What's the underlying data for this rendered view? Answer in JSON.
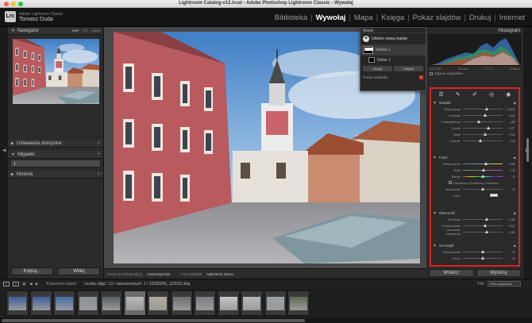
{
  "window": {
    "title": "Lightroom Catalog-v12.lrcat - Adobe Photoshop Lightroom Classic - Wywołaj"
  },
  "identity": {
    "badge": "Lrc",
    "line1": "Adobe Lightroom Classic",
    "line2": "Tomasz Duda"
  },
  "modules": [
    {
      "label": "Biblioteka",
      "active": false
    },
    {
      "label": "Wywołaj",
      "active": true
    },
    {
      "label": "Mapa",
      "active": false
    },
    {
      "label": "Księga",
      "active": false
    },
    {
      "label": "Pokaz slajdów",
      "active": false
    },
    {
      "label": "Drukuj",
      "active": false
    },
    {
      "label": "Internet",
      "active": false
    }
  ],
  "left_panel": {
    "navigator": {
      "title": "Nawigator",
      "modes": [
        "DOP",
        "FIT",
        "100%"
      ]
    },
    "presets": {
      "title": "Ustawienia domyślne"
    },
    "snapshots": {
      "title": "Migawki",
      "item": "1"
    },
    "history": {
      "title": "Historia"
    },
    "buttons": {
      "copy": "Kopiuj...",
      "paste": "Wklej"
    }
  },
  "toolbar": {
    "show_edit_label": "Pokaż przebieg edycji:",
    "show_edit_value": "Automatycznie",
    "overlay_label": "Tryb nakładki:",
    "overlay_value": "Nałożenie koloru"
  },
  "masks": {
    "header": "Maski",
    "create": "Utwórz nową maskę",
    "items": [
      "Maska 1",
      "Niebo 1"
    ],
    "buttons": [
      "Dodaj",
      "Odejmij"
    ],
    "overlay_label": "Pokaż nakładkę"
  },
  "right_panel": {
    "histogram": {
      "title": "Histogram",
      "info": [
        "ISO 200",
        "24 mm",
        "f / 7,1",
        "1/250 s"
      ],
      "original": "Zdjęcie oryginalne"
    },
    "tools": [
      "sliders-icon",
      "healing-icon",
      "brush-icon",
      "redeye-icon",
      "masking-icon"
    ],
    "sections": [
      {
        "name": "Światło",
        "sliders": [
          {
            "label": "Ekspozycja",
            "value": "+ 1,10",
            "pos": 0.6
          },
          {
            "label": "Kontrast",
            "value": "+ 10",
            "pos": 0.55
          },
          {
            "label": "Podświetlenia",
            "value": "- 23",
            "pos": 0.4
          },
          {
            "label": "Cienie",
            "value": "+ 27",
            "pos": 0.63
          },
          {
            "label": "Biele",
            "value": "+ 14",
            "pos": 0.56
          },
          {
            "label": "Czernie",
            "value": "- 14",
            "pos": 0.43
          }
        ]
      },
      {
        "name": "Kolor",
        "sliders": [
          {
            "label": "Temperatura",
            "value": "+ 15",
            "pos": 0.58
          },
          {
            "label": "Tinta",
            "value": "+ 5",
            "pos": 0.52
          },
          {
            "label": "Barwa",
            "value": "0",
            "pos": 0.5
          }
        ],
        "checkbox": "Zachowaj przybliżony poprawkę",
        "sliders2": [
          {
            "label": "Nasycenie",
            "value": "0",
            "pos": 0.5
          }
        ],
        "color_label": "Kolor"
      },
      {
        "name": "Obecność",
        "sliders": [
          {
            "label": "Struktura",
            "value": "+ 20",
            "pos": 0.6
          },
          {
            "label": "Przejrzystość",
            "value": "+ 10",
            "pos": 0.55
          },
          {
            "label": "Usuwanie zamglenia",
            "value": "+ 20",
            "pos": 0.6
          }
        ]
      },
      {
        "name": "Szczegół",
        "sliders": [
          {
            "label": "Wyostrzanie",
            "value": "0",
            "pos": 0.5
          },
          {
            "label": "Szum",
            "value": "0",
            "pos": 0.5
          }
        ]
      }
    ],
    "buttons": {
      "reset": "Wstecz",
      "reset_all": "Wyzeruj"
    }
  },
  "filmstrip": {
    "source": "Poprzedni import",
    "count": "Liczba zdjęć: 13 / zaznaczonych: 1 / 20230205_122632.dng",
    "filter_label": "Filtr:",
    "filter_value": "Filtry wyłączone",
    "selected_index": 5,
    "thumb_count": 13
  }
}
